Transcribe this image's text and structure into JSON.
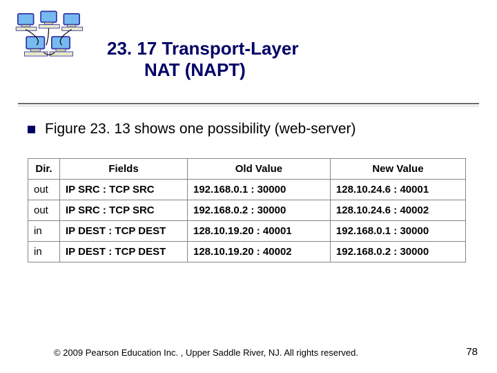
{
  "header": {
    "title_line1": "23. 17  Transport-Layer",
    "title_line2": "NAT (NAPT)"
  },
  "main": {
    "bullet_text": "Figure 23. 13 shows one possibility (web-server)"
  },
  "table": {
    "headers": {
      "dir": "Dir.",
      "fields": "Fields",
      "old": "Old Value",
      "new": "New Value"
    },
    "rows": [
      {
        "dir": "out",
        "fields": "IP SRC : TCP SRC",
        "old": "192.168.0.1 : 30000",
        "new": "128.10.24.6 : 40001"
      },
      {
        "dir": "out",
        "fields": "IP SRC : TCP SRC",
        "old": "192.168.0.2 : 30000",
        "new": "128.10.24.6 : 40002"
      },
      {
        "dir": "in",
        "fields": "IP DEST : TCP DEST",
        "old": "128.10.19.20 : 40001",
        "new": "192.168.0.1 : 30000"
      },
      {
        "dir": "in",
        "fields": "IP DEST : TCP DEST",
        "old": "128.10.19.20 : 40002",
        "new": "192.168.0.2 : 30000"
      }
    ]
  },
  "footer": {
    "copyright": "© 2009 Pearson Education Inc. , Upper Saddle River, NJ. All rights reserved.",
    "page": "78"
  },
  "colors": {
    "title": "#000066",
    "monitor_border": "#2a2aa0",
    "monitor_screen": "#6fb7f0"
  }
}
